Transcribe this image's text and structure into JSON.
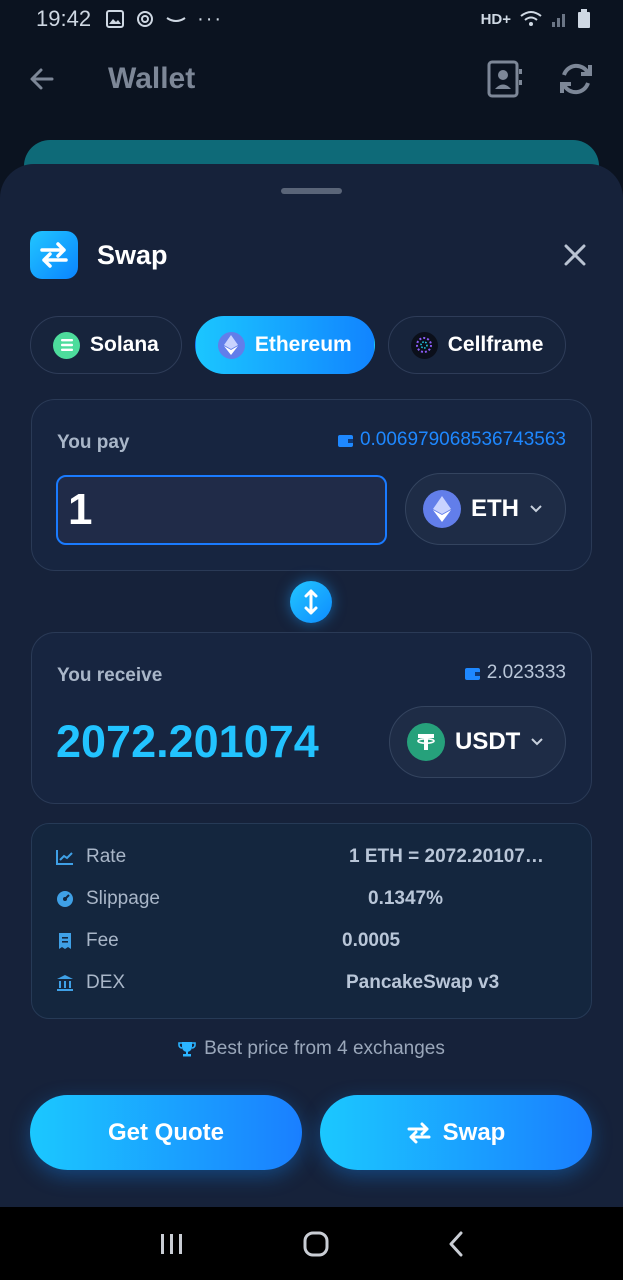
{
  "status_bar": {
    "time": "19:42",
    "network": "HD+"
  },
  "app_bar": {
    "title": "Wallet"
  },
  "sheet": {
    "title": "Swap",
    "networks": [
      {
        "label": "Solana",
        "active": false,
        "color": "#4ddc9c"
      },
      {
        "label": "Ethereum",
        "active": true,
        "color": "#627eea"
      },
      {
        "label": "Cellframe",
        "active": false,
        "color": "#0b0f1a"
      }
    ],
    "pay": {
      "label": "You pay",
      "balance": "0.006979068536743563",
      "amount": "1",
      "token": "ETH"
    },
    "receive": {
      "label": "You receive",
      "balance": "2.023333",
      "amount": "2072.201074",
      "token": "USDT"
    },
    "info": {
      "rate_label": "Rate",
      "rate_value": "1 ETH = 2072.20107…",
      "slippage_label": "Slippage",
      "slippage_value": "0.1347%",
      "fee_label": "Fee",
      "fee_value": "0.0005",
      "dex_label": "DEX",
      "dex_value": "PancakeSwap v3"
    },
    "best_price": "Best price from 4 exchanges",
    "quote_button": "Get Quote",
    "swap_button": "Swap"
  },
  "colors": {
    "accent": "#1bc6ff",
    "accent_dark": "#1184ff",
    "background": "#16223a",
    "usdt": "#26a17b",
    "eth": "#627eea"
  }
}
